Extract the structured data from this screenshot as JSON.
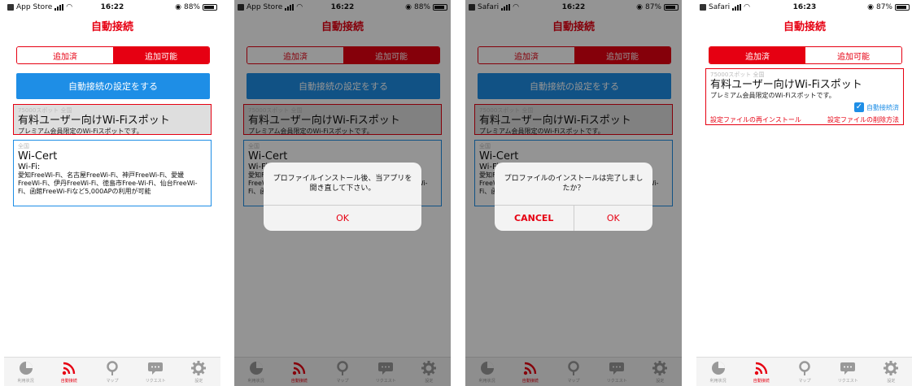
{
  "tabs": [
    {
      "label": "利用状況",
      "icon": "pie-chart-icon"
    },
    {
      "label": "自動接続",
      "icon": "wifi-signal-icon"
    },
    {
      "label": "マップ",
      "icon": "map-pin-icon"
    },
    {
      "label": "リクエスト",
      "icon": "chat-bubble-icon"
    },
    {
      "label": "設定",
      "icon": "gear-icon"
    }
  ],
  "accent_color": "#e60012",
  "blue_color": "#1e8ee6",
  "screens": [
    {
      "status": {
        "carrier": "App Store",
        "time": "16:22",
        "battery": "88%",
        "battery_level": 0.88
      },
      "title": "自動接続",
      "segment": {
        "left": "追加済",
        "right": "追加可能"
      },
      "setup_button": "自動接続の設定をする",
      "card1": {
        "meta": "75000スポット 全国",
        "title": "有料ユーザー向けWi-Fiスポット",
        "sub": "プレミアム会員限定のWi-Fiスポットです。"
      },
      "card2": {
        "meta": "全国",
        "title": "Wi-Cert",
        "wifi_label": "Wi-Fi:",
        "body": "愛知FreeWi-Fi、名古屋FreeWi-Fi、神戸FreeWi-Fi、愛媛FreeWi-Fi、伊丹FreeWi-Fi、徳島市Free-Wi-Fi、仙台FreeWi-Fi、函館FreeWi-Fiなど5,000APの利用が可能"
      }
    },
    {
      "status": {
        "carrier": "App Store",
        "time": "16:22",
        "battery": "88%",
        "battery_level": 0.88
      },
      "alert": {
        "message": "プロファイルインストール後、当アプリを開き直して下さい。",
        "ok": "OK"
      }
    },
    {
      "status": {
        "carrier": "Safari",
        "time": "16:22",
        "battery": "87%",
        "battery_level": 0.87
      },
      "alert": {
        "message": "プロファイルのインストールは完了しましたか？",
        "cancel": "CANCEL",
        "ok": "OK"
      }
    },
    {
      "status": {
        "carrier": "Safari",
        "time": "16:23",
        "battery": "87%",
        "battery_level": 0.87
      },
      "title": "自動接続",
      "segment": {
        "left": "追加済",
        "right": "追加可能"
      },
      "card1": {
        "meta": "75000スポット 全国",
        "title": "有料ユーザー向けWi-Fiスポット",
        "sub": "プレミアム会員限定のWi-Fiスポットです。",
        "checkbox_label": "自動接続済",
        "reinstall": "設定ファイルの再インストール",
        "delete": "設定ファイルの削除方法"
      }
    }
  ]
}
